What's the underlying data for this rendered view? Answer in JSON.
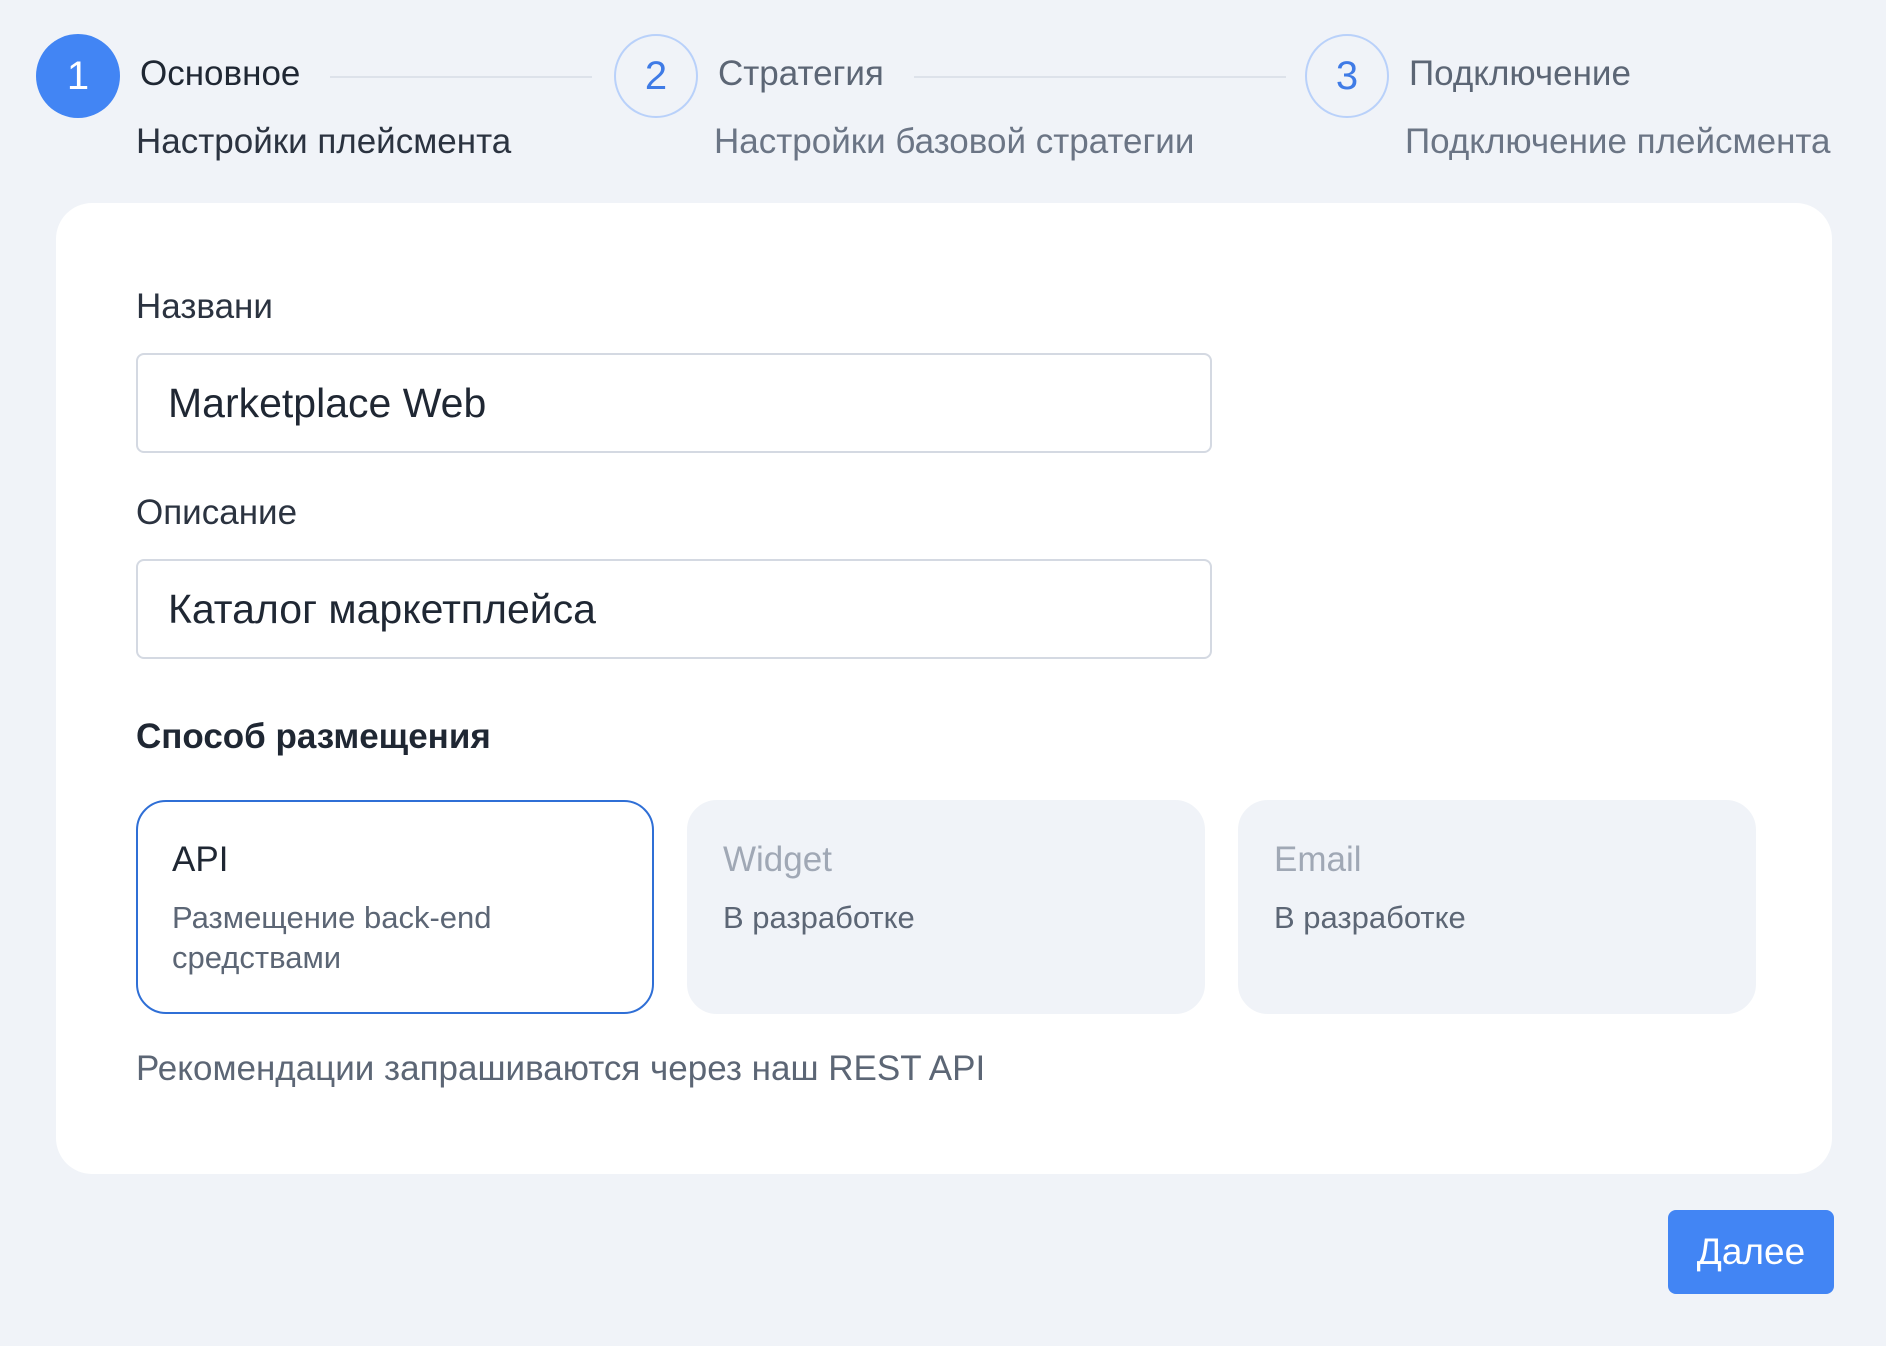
{
  "stepper": {
    "steps": [
      {
        "number": "1",
        "title": "Основное",
        "subtitle": "Настройки плейсмента",
        "state": "active"
      },
      {
        "number": "2",
        "title": "Стратегия",
        "subtitle": "Настройки базовой стратегии",
        "state": "upcoming"
      },
      {
        "number": "3",
        "title": "Подключение",
        "subtitle": "Подключение плейсмента",
        "state": "upcoming"
      }
    ]
  },
  "form": {
    "name": {
      "label": "Названи",
      "value": "Marketplace Web"
    },
    "description": {
      "label": "Описание",
      "value": "Каталог маркетплейса"
    },
    "placement": {
      "title": "Способ размещения",
      "options": [
        {
          "title": "API",
          "description": "Размещение back-end средствами",
          "state": "selected"
        },
        {
          "title": "Widget",
          "description": "В разработке",
          "state": "disabled"
        },
        {
          "title": "Email",
          "description": "В разработке",
          "state": "disabled"
        }
      ],
      "hint": "Рекомендации запрашиваются через наш REST API"
    }
  },
  "actions": {
    "next_label": "Далее"
  },
  "colors": {
    "accent": "#4285f4",
    "selected_border": "#2f6fd6",
    "background": "#f0f3f8",
    "card": "#ffffff"
  }
}
